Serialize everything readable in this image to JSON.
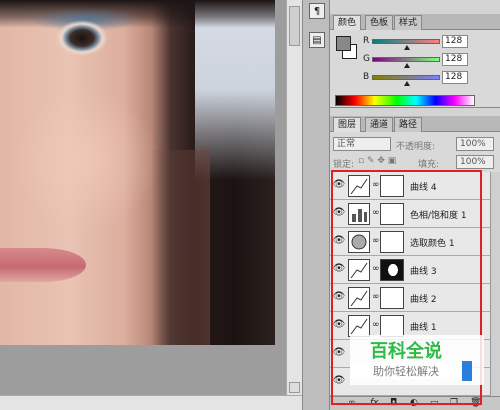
{
  "color_panel": {
    "tabs": [
      "颜色",
      "色板",
      "样式"
    ],
    "active_tab": 0,
    "channels": [
      {
        "label": "R",
        "value": "128",
        "gradient": "#ff0000"
      },
      {
        "label": "G",
        "value": "128",
        "gradient": "#00ff00"
      },
      {
        "label": "B",
        "value": "128",
        "gradient": "#0000ff"
      }
    ],
    "foreground_color": "#808080",
    "background_color": "#ffffff"
  },
  "layers_panel": {
    "tabs": [
      "图层",
      "通道",
      "路径"
    ],
    "active_tab": 0,
    "blend_mode": "正常",
    "opacity_label": "不透明度:",
    "opacity_value": "100%",
    "lock_label": "锁定:",
    "fill_label": "填充:",
    "fill_value": "100%",
    "layers": [
      {
        "name": "曲线 4",
        "type": "curves",
        "mask": "white"
      },
      {
        "name": "色相/饱和度 1",
        "type": "hue-saturation",
        "mask": "white"
      },
      {
        "name": "选取颜色 1",
        "type": "selective-color",
        "mask": "white"
      },
      {
        "name": "曲线 3",
        "type": "curves",
        "mask": "dark"
      },
      {
        "name": "曲线 2",
        "type": "curves",
        "mask": "white"
      },
      {
        "name": "曲线 1",
        "type": "curves",
        "mask": "white"
      }
    ],
    "bottom_icons": [
      "link-icon",
      "fx-icon",
      "mask-icon",
      "adjustment-icon",
      "folder-icon",
      "new-layer-icon",
      "trash-icon"
    ]
  },
  "highlight_color": "#dd2222",
  "watermark": {
    "title": "百科全说",
    "subtitle": "助你轻松解决",
    "title_color": "#2dbb44"
  }
}
